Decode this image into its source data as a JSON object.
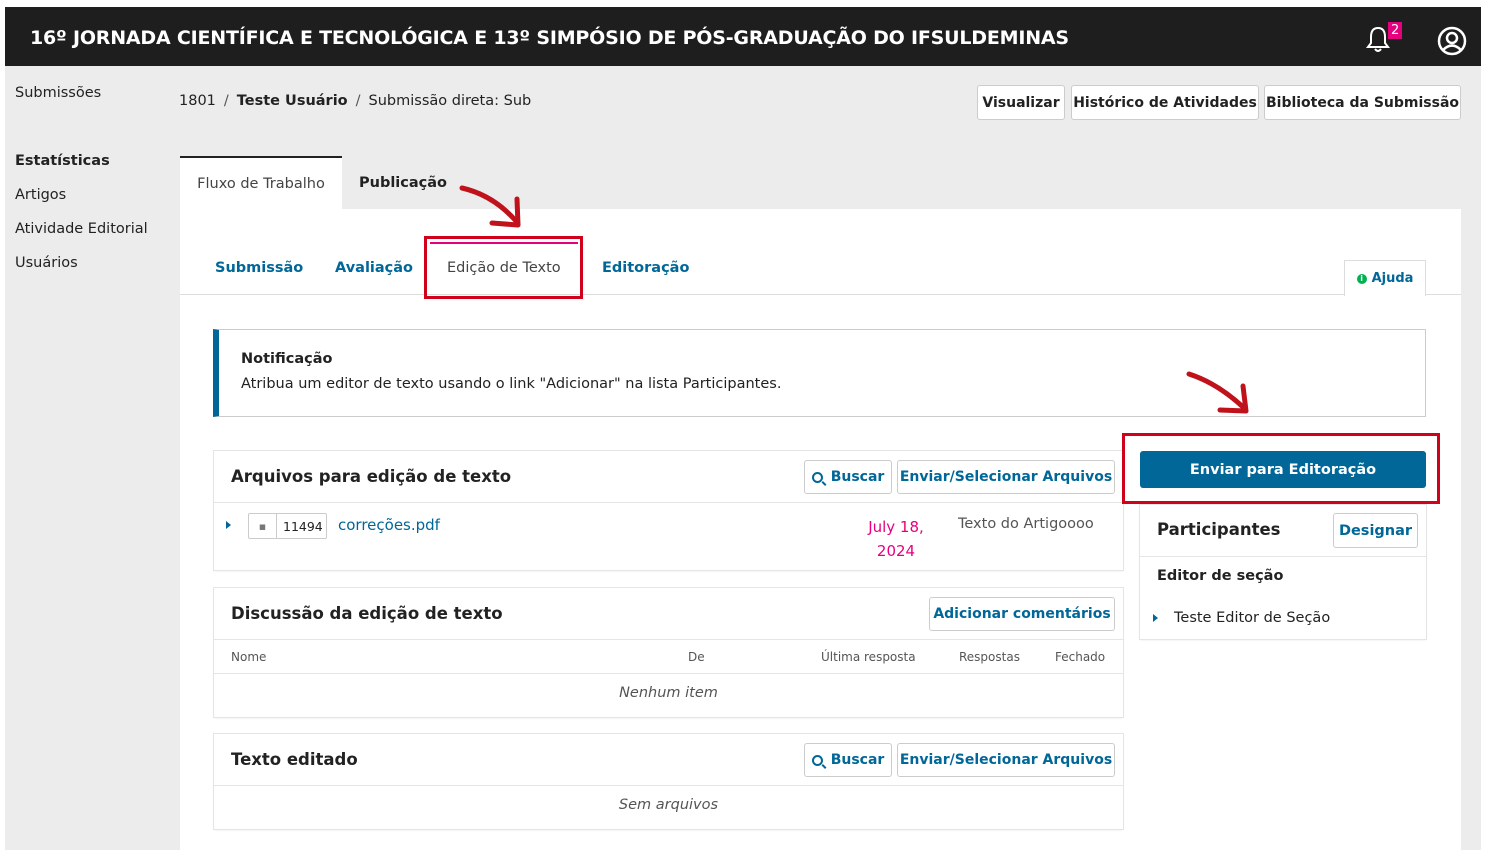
{
  "header": {
    "site_title": "16º JORNADA CIENTÍFICA E TECNOLÓGICA E 13º SIMPÓSIO DE PÓS-GRADUAÇÃO DO IFSULDEMINAS",
    "notification_count": "2"
  },
  "sidebar": {
    "submissions": "Submissões",
    "statistics_heading": "Estatísticas",
    "items": [
      "Artigos",
      "Atividade Editorial",
      "Usuários"
    ]
  },
  "breadcrumb": {
    "id": "1801",
    "author": "Teste Usuário",
    "title": "Submissão direta: Sub",
    "separator": "/"
  },
  "header_buttons": {
    "view": "Visualizar",
    "history": "Histórico de Atividades",
    "library": "Biblioteca da Submissão"
  },
  "main_tabs": {
    "workflow": "Fluxo de Trabalho",
    "publication": "Publicação"
  },
  "stage_tabs": {
    "submission": "Submissão",
    "review": "Avaliação",
    "copyediting": "Edição de Texto",
    "production": "Editoração",
    "help": "Ajuda"
  },
  "notice": {
    "title": "Notificação",
    "text": "Atribua um editor de texto usando o link \"Adicionar\" na lista Participantes."
  },
  "files_card": {
    "title": "Arquivos para edição de texto",
    "search": "Buscar",
    "upload": "Enviar/Selecionar Arquivos",
    "file": {
      "id": "11494",
      "name": "correções.pdf",
      "date_line1": "July 18,",
      "date_line2": "2024",
      "type": "Texto do Artigoooo"
    }
  },
  "discussion_card": {
    "title": "Discussão da edição de texto",
    "add": "Adicionar comentários",
    "columns": [
      "Nome",
      "De",
      "Última resposta",
      "Respostas",
      "Fechado"
    ],
    "empty": "Nenhum item"
  },
  "edited_card": {
    "title": "Texto editado",
    "search": "Buscar",
    "upload": "Enviar/Selecionar Arquivos",
    "empty": "Sem arquivos"
  },
  "actions": {
    "send_to_production": "Enviar para Editoração"
  },
  "participants": {
    "title": "Participantes",
    "assign": "Designar",
    "role": "Editor de seção",
    "member": "Teste Editor de Seção"
  },
  "colors": {
    "primary": "#006798",
    "accent": "#e5007e",
    "annotation_red": "#d0021b",
    "topbar": "#1e1e1e"
  }
}
